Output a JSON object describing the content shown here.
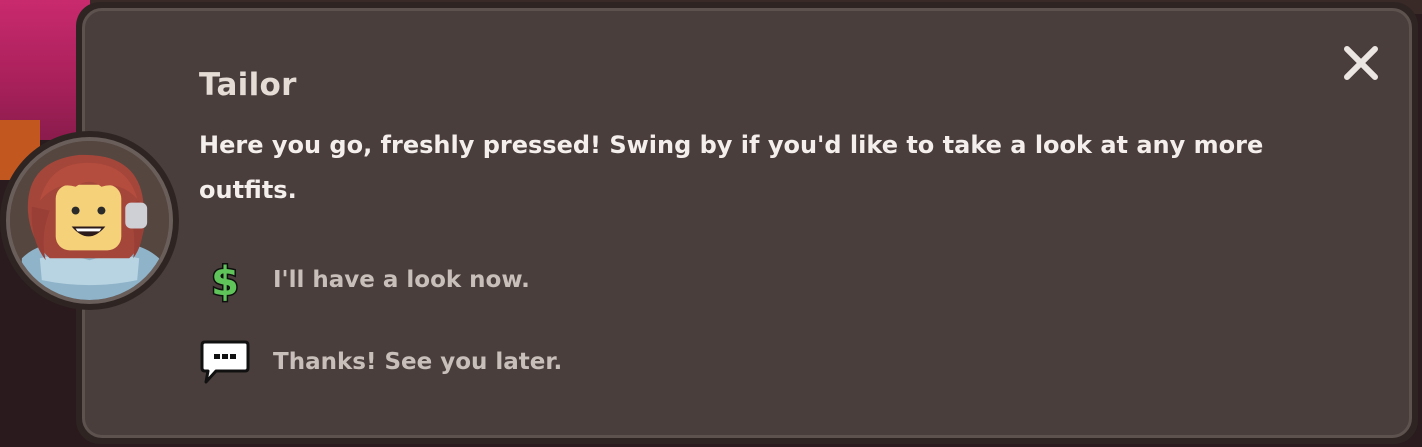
{
  "dialog": {
    "speaker_name": "Tailor",
    "message": "Here you go, freshly pressed! Swing by if you'd like to take a look at any more outfits.",
    "options": [
      {
        "label": "I'll have a look now.",
        "icon": "dollar-icon",
        "icon_color": "#5fc45a"
      },
      {
        "label": "Thanks! See you later.",
        "icon": "chat-bubble-icon",
        "icon_color": "#ffffff"
      }
    ],
    "close_icon": "close-icon"
  },
  "colors": {
    "panel": "#4a3e3c",
    "panel_border": "#2e2523",
    "name_text": "#e6dcd6",
    "message_text": "#f4efec",
    "option_text": "#c9bfba"
  }
}
